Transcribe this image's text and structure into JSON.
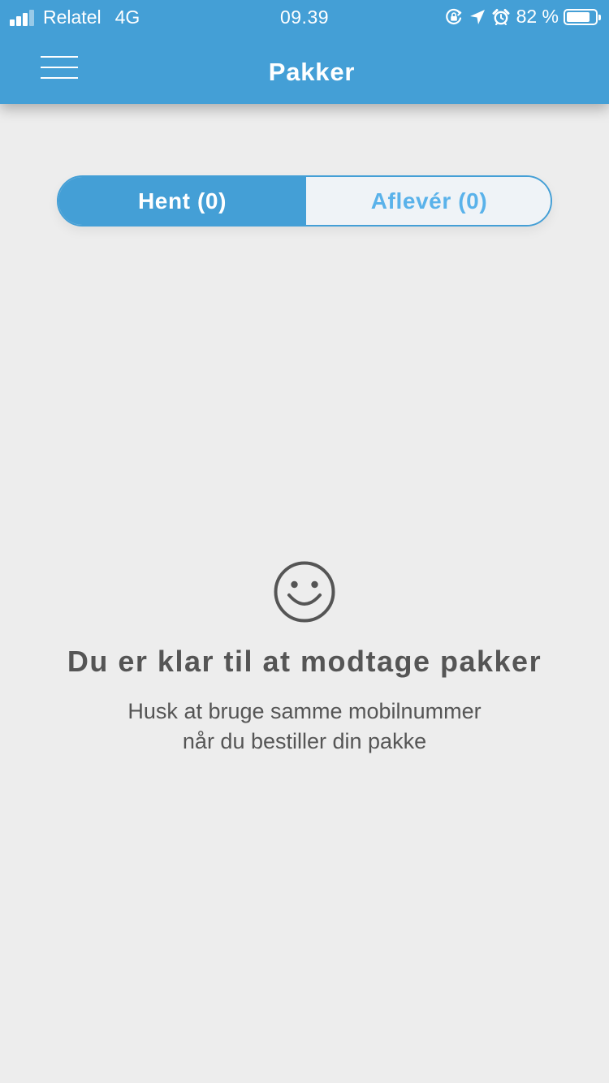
{
  "status_bar": {
    "carrier": "Relatel",
    "network": "4G",
    "time": "09.39",
    "battery_text": "82 %",
    "battery_level": 0.82,
    "signal_bars": 3,
    "icons": [
      "orientation-lock-icon",
      "location-arrow-icon",
      "alarm-icon",
      "battery-icon"
    ]
  },
  "nav": {
    "title": "Pakker",
    "menu_icon": "hamburger-menu-icon"
  },
  "tabs": [
    {
      "label": "Hent (0)",
      "active": true
    },
    {
      "label": "Aflevér (0)",
      "active": false
    }
  ],
  "empty_state": {
    "icon": "smiley-icon",
    "title": "Du er klar til at modtage pakker",
    "hint_line1": "Husk at bruge samme mobilnummer",
    "hint_line2": "når du bestiller din pakke"
  },
  "colors": {
    "accent": "#449fd6",
    "background": "#ededed",
    "text": "#555555",
    "inactive_tab_text": "#5ab2ea"
  }
}
